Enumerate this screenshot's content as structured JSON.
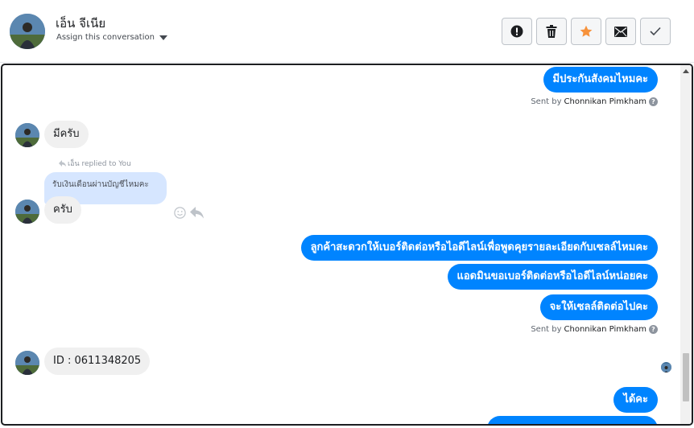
{
  "header": {
    "contact_name": "เอ็น จีเนีย",
    "assign_label": "Assign this conversation",
    "toolbar": [
      {
        "name": "mark-spam-button",
        "icon": "exclamation-circle-icon"
      },
      {
        "name": "delete-button",
        "icon": "trash-icon"
      },
      {
        "name": "star-button",
        "icon": "star-icon",
        "color": "#f7923b"
      },
      {
        "name": "mark-unread-button",
        "icon": "envelope-icon"
      },
      {
        "name": "mark-done-button",
        "icon": "check-icon"
      }
    ]
  },
  "messages": {
    "m1": "มีประกันสังคมไหมคะ",
    "sent_by_1": {
      "prefix": "Sent by",
      "name": "Chonnikan Pimkham"
    },
    "m2": "มีครับ",
    "reply_notice": "เอ็น replied to You",
    "quoted": "รับเงินเดือนผ่านบัญชีไหมคะ",
    "m3": "ครับ",
    "m4": "ลูกค้าสะดวกให้เบอร์ติดต่อหรือไอดีไลน์เพื่อพูดคุยรายละเอียดกับเซลล์ไหมคะ",
    "m5": "แอดมินขอเบอร์ติดต่อหรือไอดีไลน์หน่อยคะ",
    "m6": "จะให้เซลล์ติดต่อไปคะ",
    "sent_by_2": {
      "prefix": "Sent by",
      "name": "Chonnikan Pimkham"
    },
    "m7": "ID : 0611348205",
    "m8": "ได้คะ"
  },
  "colors": {
    "outgoing_bubble": "#0084ff",
    "incoming_bubble": "#f0f0f0",
    "quoted_bubble": "#d6e6ff",
    "star_accent": "#f7923b"
  }
}
